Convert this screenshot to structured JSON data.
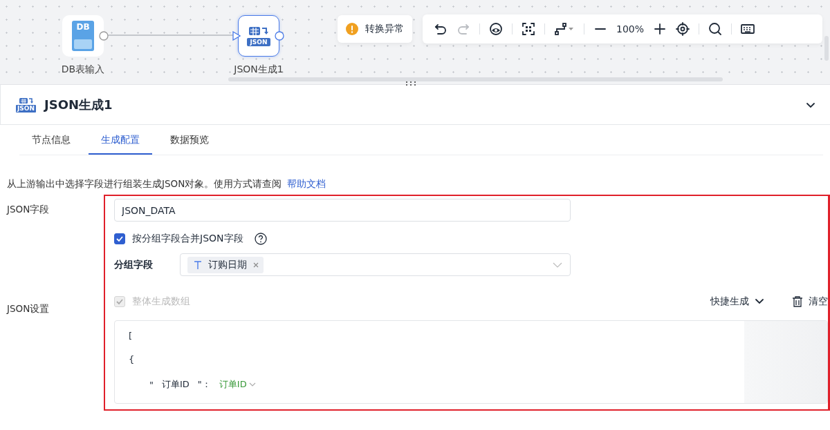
{
  "canvas": {
    "nodes": [
      {
        "label": "DB表输入",
        "icon_text": "DB",
        "kind": "db",
        "selected": false
      },
      {
        "label": "JSON生成1",
        "icon_text": "JSON",
        "kind": "json",
        "selected": true
      }
    ],
    "toast": {
      "text": "转换异常"
    },
    "toolbar": [
      {
        "kind": "undo",
        "disabled": false
      },
      {
        "kind": "redo",
        "disabled": true
      },
      {
        "kind": "divider"
      },
      {
        "kind": "eye",
        "disabled": false
      },
      {
        "kind": "divider"
      },
      {
        "kind": "fit",
        "disabled": false
      },
      {
        "kind": "divider"
      },
      {
        "kind": "connector",
        "disabled": false
      },
      {
        "kind": "divider"
      },
      {
        "kind": "zoom_out",
        "disabled": false
      },
      {
        "kind": "zoom",
        "text": "100%"
      },
      {
        "kind": "zoom_in",
        "disabled": false
      },
      {
        "kind": "locate",
        "disabled": false
      },
      {
        "kind": "divider"
      },
      {
        "kind": "search",
        "disabled": false
      },
      {
        "kind": "divider"
      },
      {
        "kind": "keyboard",
        "disabled": false
      }
    ]
  },
  "panel": {
    "title": "JSON生成1",
    "icon_text": "JSON",
    "tabs": [
      {
        "label": "节点信息",
        "selected": false
      },
      {
        "label": "生成配置",
        "selected": true
      },
      {
        "label": "数据预览",
        "selected": false
      }
    ],
    "description": "从上游输出中选择字段进行组装生成JSON对象。使用方式请查阅",
    "help_link": "帮助文档",
    "json_field": {
      "label": "JSON字段",
      "value": "JSON_DATA"
    },
    "merge_checkbox": {
      "label": "按分组字段合并JSON字段",
      "checked": true
    },
    "group_field": {
      "label": "分组字段",
      "tags": [
        {
          "text": "订购日期"
        }
      ]
    },
    "json_settings": {
      "label": "JSON设置",
      "array_checkbox": {
        "label": "整体生成数组",
        "checked": true,
        "disabled": true
      },
      "quick_generate": "快捷生成",
      "clear": "清空",
      "lines": [
        {
          "kind": "text",
          "text": "["
        },
        {
          "kind": "text",
          "text": "{"
        },
        {
          "kind": "pair",
          "open": "\"",
          "key": "订单ID",
          "close": "\"：",
          "value": "订单ID"
        }
      ]
    }
  }
}
